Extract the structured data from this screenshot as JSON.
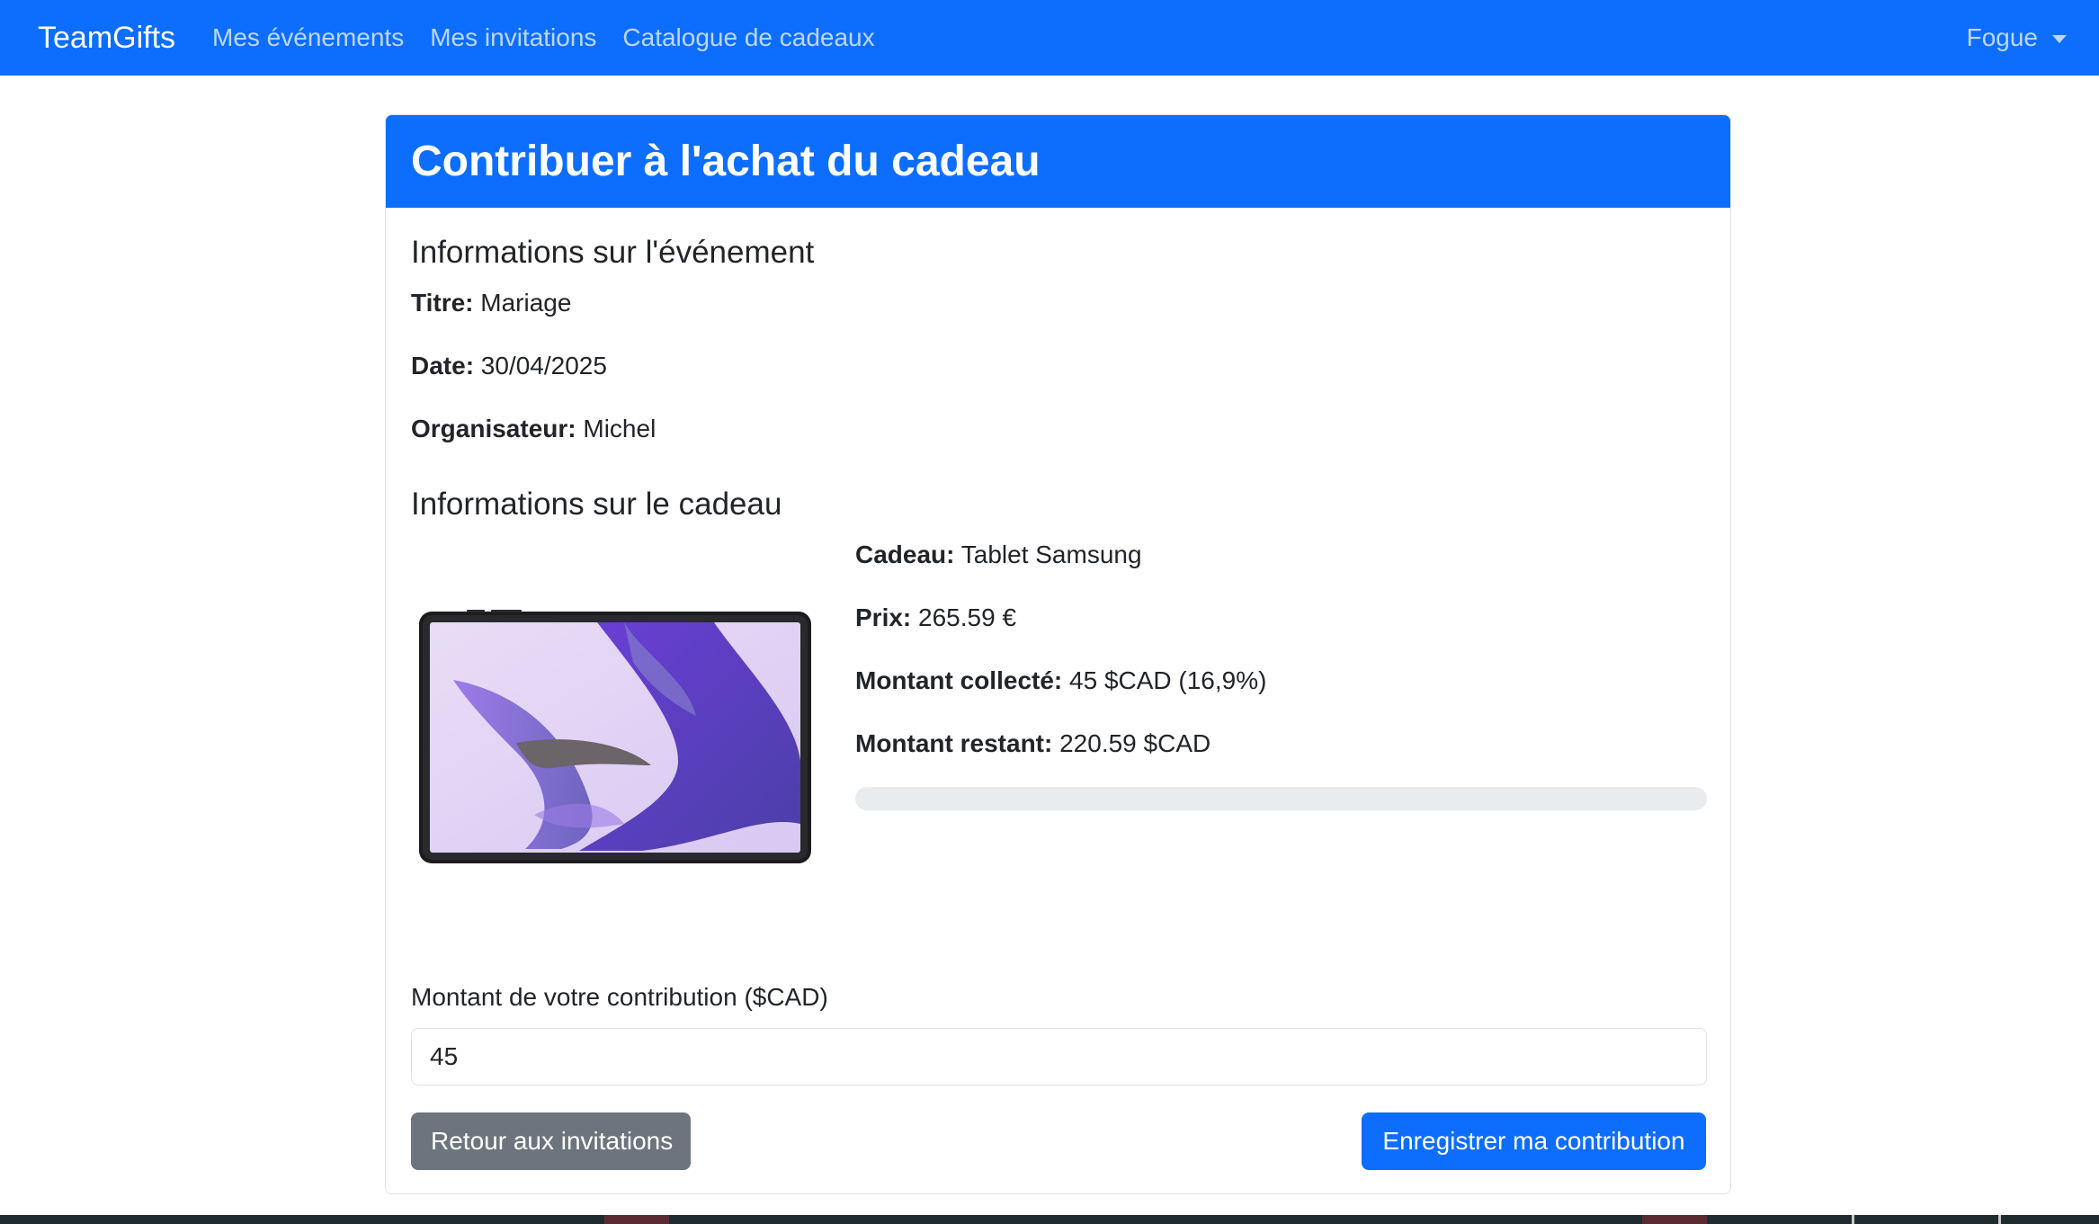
{
  "navbar": {
    "brand": "TeamGifts",
    "links": [
      "Mes événements",
      "Mes invitations",
      "Catalogue de cadeaux"
    ],
    "user": "Fogue"
  },
  "page": {
    "title": "Contribuer à l'achat du cadeau"
  },
  "event": {
    "section_title": "Informations sur l'événement",
    "title_label": "Titre:",
    "title_value": "Mariage",
    "date_label": "Date:",
    "date_value": "30/04/2025",
    "organizer_label": "Organisateur:",
    "organizer_value": "Michel"
  },
  "gift": {
    "section_title": "Informations sur le cadeau",
    "gift_label": "Cadeau:",
    "gift_value": "Tablet Samsung",
    "price_label": "Prix:",
    "price_value": "265.59 €",
    "collected_label": "Montant collecté:",
    "collected_value": "45 $CAD (16,9%)",
    "remaining_label": "Montant restant:",
    "remaining_value": "220.59 $CAD",
    "progress_fraction": 0,
    "image_icon": "tablet-image"
  },
  "form": {
    "label": "Montant de votre contribution ($CAD)",
    "value": "45",
    "back_button": "Retour aux invitations",
    "submit_button": "Enregistrer ma contribution"
  },
  "colors": {
    "primary": "#0d6efd",
    "secondary": "#6c757d",
    "progress_track": "#e9ecef"
  }
}
